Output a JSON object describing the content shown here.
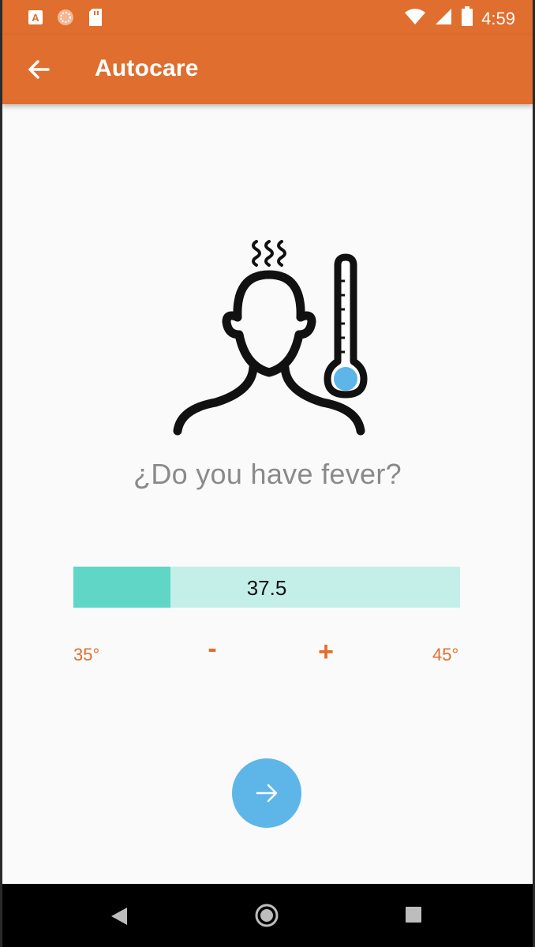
{
  "status_bar": {
    "time": "4:59",
    "icons": [
      "app-a-icon",
      "loader-icon",
      "sd-card-icon",
      "wifi-icon",
      "signal-icon",
      "battery-icon"
    ]
  },
  "app_bar": {
    "title": "Autocare",
    "back_icon": "arrow-left-icon"
  },
  "illustration": {
    "icon": "fever-head-thermometer-icon",
    "accent_color": "#5db6e7"
  },
  "question": "¿Do you have fever?",
  "temperature": {
    "value": "37.5",
    "min_label": "35°",
    "max_label": "45°",
    "min": 35,
    "max": 45,
    "current": 37.5,
    "decrement_label": "-",
    "increment_label": "+"
  },
  "next_button": {
    "icon": "arrow-right-icon"
  },
  "nav_bar": {
    "icons": [
      "back-triangle-icon",
      "home-circle-icon",
      "recents-square-icon"
    ]
  },
  "colors": {
    "primary": "#e06e2e",
    "slider_track": "#c4efe9",
    "slider_fill": "#60d6c6",
    "fab": "#5db6e7"
  }
}
